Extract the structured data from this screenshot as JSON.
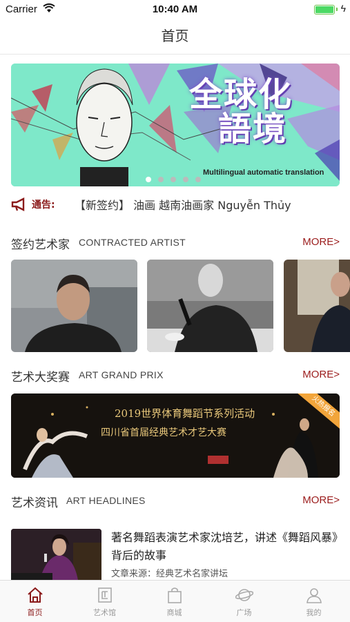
{
  "status_bar": {
    "carrier": "Carrier",
    "time": "10:40 AM"
  },
  "nav": {
    "title": "首页"
  },
  "banner": {
    "title_line1": "全球化",
    "title_line2": "語境",
    "subtitle": "Multilingual automatic translation",
    "page_count": 5,
    "active_page": 1
  },
  "notice": {
    "label": "通告:",
    "text": "【新签约】 油画 越南油画家 Nguyễn Thủy"
  },
  "sections": {
    "artists": {
      "title_cn": "签约艺术家",
      "title_en": "CONTRACTED ARTIST",
      "more": "MORE>"
    },
    "prix": {
      "title_cn": "艺术大奖赛",
      "title_en": "ART GRAND PRIX",
      "more": "MORE>"
    },
    "headlines": {
      "title_cn": "艺术资讯",
      "title_en": "ART HEADLINES",
      "more": "MORE>"
    }
  },
  "prix_banner": {
    "line1": "2019世界体育舞蹈节系列活动",
    "line2": "四川省首届经典艺术才艺大赛",
    "ribbon": "火热报名"
  },
  "news": {
    "headline": "著名舞蹈表演艺术家沈培艺，讲述《舞蹈风暴》背后的故事",
    "source": "文章来源：经典艺术名家讲坛"
  },
  "tabs": [
    {
      "label": "首页",
      "icon": "home-icon",
      "active": true
    },
    {
      "label": "艺术馆",
      "icon": "gallery-icon",
      "active": false
    },
    {
      "label": "商城",
      "icon": "shopping-bag-icon",
      "active": false
    },
    {
      "label": "广场",
      "icon": "planet-icon",
      "active": false
    },
    {
      "label": "我的",
      "icon": "user-icon",
      "active": false
    }
  ],
  "colors": {
    "accent": "#8b1a1a",
    "banner_bg": "#7ee8c9",
    "tab_inactive": "#9a9a9a"
  }
}
